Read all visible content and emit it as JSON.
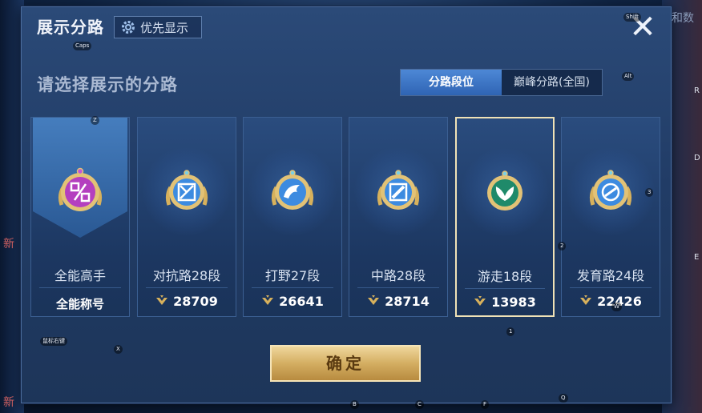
{
  "dialog": {
    "title": "展示分路",
    "priority_button": "优先显示",
    "close_label": "✕",
    "subtitle": "请选择展示的分路",
    "tabs": [
      {
        "label": "分路段位",
        "active": true
      },
      {
        "label": "巅峰分路(全国)",
        "active": false
      }
    ],
    "confirm_label": "确定"
  },
  "cards": [
    {
      "name": "全能高手",
      "bottom": "全能称号",
      "badge": "all-round-icon",
      "color": "#b43fbf",
      "selected": false
    },
    {
      "name": "对抗路28段",
      "score": "28709",
      "badge": "clash-lane-icon",
      "color": "#3d8be0",
      "selected": false
    },
    {
      "name": "打野27段",
      "score": "26641",
      "badge": "jungle-icon",
      "color": "#3d8be0",
      "selected": false
    },
    {
      "name": "中路28段",
      "score": "28714",
      "badge": "mid-lane-icon",
      "color": "#3d8be0",
      "selected": false
    },
    {
      "name": "游走18段",
      "score": "13983",
      "badge": "roam-icon",
      "color": "#1f8a6a",
      "selected": true
    },
    {
      "name": "发育路24段",
      "score": "22426",
      "badge": "farm-lane-icon",
      "color": "#3d8be0",
      "selected": false
    }
  ],
  "key_hints": {
    "caps": "Caps",
    "shift": "Shift",
    "alt": "Alt",
    "z": "Z",
    "x": "X",
    "n2": "2",
    "n3": "3",
    "n1": "1",
    "b": "B",
    "c": "C",
    "f": "F",
    "q": "Q",
    "w": "W",
    "cheats": "鼠标右键"
  },
  "edge_text": {
    "r": "R",
    "d": "D",
    "e": "E",
    "new1": "新",
    "new2": "新",
    "top_right": "和数"
  }
}
